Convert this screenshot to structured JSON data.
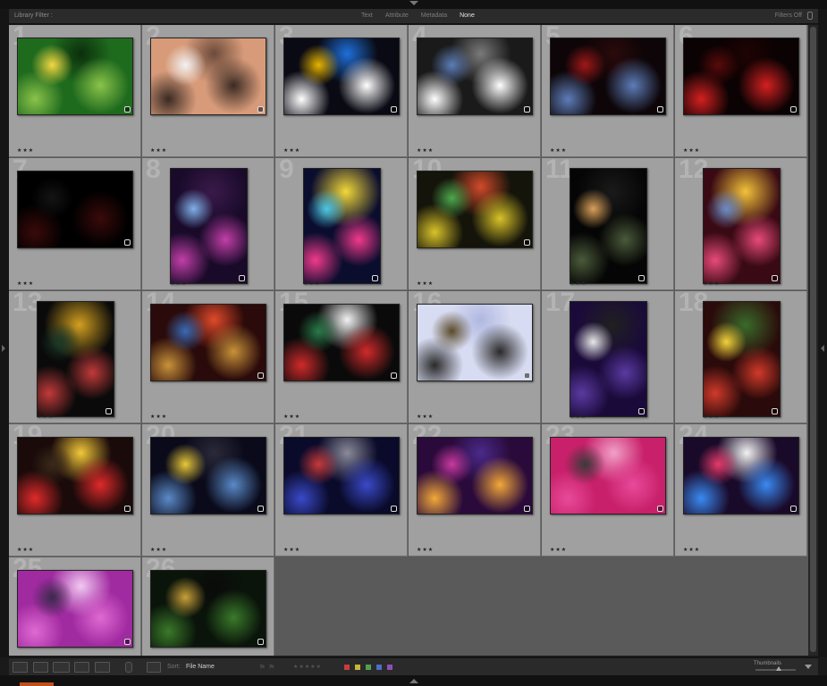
{
  "filter_bar": {
    "title": "Library Filter :",
    "tabs": [
      "Text",
      "Attribute",
      "Metadata",
      "None"
    ],
    "active_tab": "None",
    "status": "Filters Off"
  },
  "toolbar": {
    "sort_label": "Sort:",
    "sort_value": "File Name",
    "thumbnails_label": "Thumbnails",
    "color_labels": [
      "#c83c3c",
      "#c8b43c",
      "#50a050",
      "#4c6ec8",
      "#8c50b4"
    ]
  },
  "photos": [
    {
      "num": "1",
      "rating": "★★★",
      "colors": [
        "#1f6b1e",
        "#8bc34a",
        "#f5d742",
        "#0b2e0c"
      ]
    },
    {
      "num": "2",
      "rating": "★★★",
      "colors": [
        "#d89b7a",
        "#3a2a22",
        "#f2f2f2",
        "#6b4a3a"
      ]
    },
    {
      "num": "3",
      "rating": "★★★",
      "colors": [
        "#0a0a14",
        "#ffffff",
        "#e6b400",
        "#1e6fd9"
      ]
    },
    {
      "num": "4",
      "rating": "★★★",
      "colors": [
        "#1a1a1a",
        "#ffffff",
        "#5d7db8",
        "#7a7a7a"
      ]
    },
    {
      "num": "5",
      "rating": "★★★",
      "colors": [
        "#0d0508",
        "#5d7db8",
        "#a01818",
        "#2b0a0a"
      ]
    },
    {
      "num": "6",
      "rating": "★★★",
      "colors": [
        "#0a0203",
        "#d42020",
        "#5a0a0a",
        "#200303"
      ]
    },
    {
      "num": "7",
      "rating": "★★★",
      "colors": [
        "#000000",
        "#3a0a0a",
        "#141414",
        "#000000"
      ]
    },
    {
      "num": "8",
      "rating": "★★★",
      "colors": [
        "#190a2a",
        "#c23fa8",
        "#7fb0e8",
        "#3a1a4a"
      ]
    },
    {
      "num": "9",
      "rating": "★★★",
      "colors": [
        "#0b0d2e",
        "#f23a8c",
        "#49c6e5",
        "#f2d83a"
      ]
    },
    {
      "num": "10",
      "rating": "★★★",
      "colors": [
        "#14140a",
        "#d9c32a",
        "#4ea84e",
        "#d24a2a"
      ]
    },
    {
      "num": "11",
      "rating": "★★★",
      "colors": [
        "#050505",
        "#4a5a3a",
        "#d8a05a",
        "#1a1a1a"
      ]
    },
    {
      "num": "12",
      "rating": "★★★",
      "colors": [
        "#3a0a14",
        "#e84a7a",
        "#6a8cc8",
        "#f2c23a"
      ]
    },
    {
      "num": "13",
      "rating": "★★★",
      "colors": [
        "#0a0a0a",
        "#c23a3a",
        "#1a3a2a",
        "#d2a020"
      ]
    },
    {
      "num": "14",
      "rating": "★★★",
      "colors": [
        "#2a0a0a",
        "#c8923a",
        "#3a6ab4",
        "#e04a2a"
      ]
    },
    {
      "num": "15",
      "rating": "★★★",
      "colors": [
        "#0a0a0a",
        "#d02a2a",
        "#2a7a4a",
        "#f2f2f2"
      ]
    },
    {
      "num": "16",
      "rating": "★★★",
      "colors": [
        "#d8dcf2",
        "#2a2a2a",
        "#5a4a2a",
        "#b0b8e0"
      ]
    },
    {
      "num": "17",
      "rating": "★★★",
      "colors": [
        "#1a0a3a",
        "#5a3aa0",
        "#e8e8e8",
        "#202020"
      ]
    },
    {
      "num": "18",
      "rating": "★★★",
      "colors": [
        "#2a0a0a",
        "#d23a2a",
        "#f2d23a",
        "#3a6a2a"
      ]
    },
    {
      "num": "19",
      "rating": "★★★",
      "colors": [
        "#1a0a0a",
        "#e02a2a",
        "#3a2a1a",
        "#f2c83a"
      ]
    },
    {
      "num": "20",
      "rating": "★★★",
      "colors": [
        "#0a0a1a",
        "#5a8ac8",
        "#e8c83a",
        "#2a2a3a"
      ]
    },
    {
      "num": "21",
      "rating": "★★★",
      "colors": [
        "#0a0a2a",
        "#3a4ac8",
        "#c83a3a",
        "#8a8a9a"
      ]
    },
    {
      "num": "22",
      "rating": "★★★",
      "colors": [
        "#2a0a3a",
        "#f2a83a",
        "#c83aa0",
        "#4a2a8a"
      ]
    },
    {
      "num": "23",
      "rating": "★★★",
      "colors": [
        "#c8206a",
        "#e84a9a",
        "#3a3a3a",
        "#f2a0c8"
      ]
    },
    {
      "num": "24",
      "rating": "★★★",
      "colors": [
        "#1a0a2a",
        "#3a8af2",
        "#e83a6a",
        "#f2f2f2"
      ]
    },
    {
      "num": "25",
      "rating": "★★★",
      "colors": [
        "#a02aa0",
        "#e06ad2",
        "#3a2a4a",
        "#f2c8f2"
      ]
    },
    {
      "num": "26",
      "rating": "★★★",
      "colors": [
        "#0a140a",
        "#3a7a2a",
        "#c8a03a",
        "#0a0a0a"
      ]
    }
  ]
}
